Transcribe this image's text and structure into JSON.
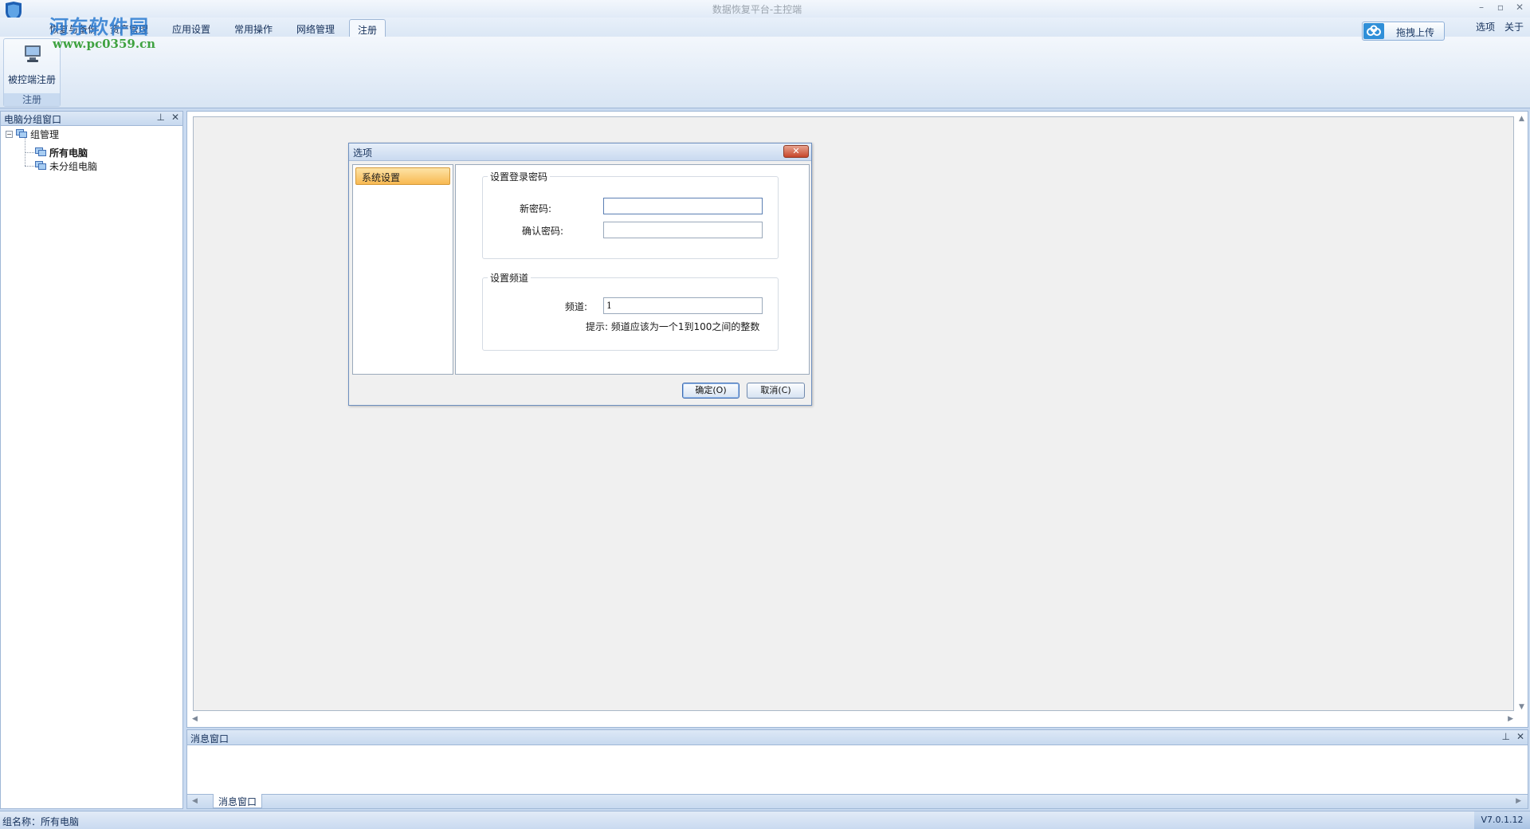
{
  "window": {
    "title": "数据恢复平台-主控端"
  },
  "watermark": {
    "text": "河东软件园",
    "url": "www.pc0359.cn"
  },
  "tabs": [
    {
      "label": "恢复与备份"
    },
    {
      "label": "资产管理"
    },
    {
      "label": "应用设置"
    },
    {
      "label": "常用操作"
    },
    {
      "label": "网络管理"
    },
    {
      "label": "注册",
      "active": true
    }
  ],
  "top_links": {
    "options": "选项",
    "about": "关于"
  },
  "upload_button": {
    "label": "拖拽上传"
  },
  "ribbon": {
    "button_label": "被控端注册",
    "group_label": "注册"
  },
  "left_panel": {
    "title": "电脑分组窗口",
    "tree": {
      "root": "组管理",
      "children": [
        "所有电脑",
        "未分组电脑"
      ]
    }
  },
  "dialog": {
    "title": "选项",
    "nav_item": "系统设置",
    "password_group": {
      "legend": "设置登录密码",
      "new_password_label": "新密码:",
      "confirm_password_label": "确认密码:",
      "new_password_value": "",
      "confirm_password_value": ""
    },
    "channel_group": {
      "legend": "设置频道",
      "channel_label": "频道:",
      "channel_value": "1",
      "hint": "提示: 频道应该为一个1到100之间的整数"
    },
    "ok_button": "确定(O)",
    "cancel_button": "取消(C)"
  },
  "message_window": {
    "title": "消息窗口",
    "tab_label": "消息窗口"
  },
  "statusbar": {
    "group_name": "组名称：所有电脑",
    "version": "V7.0.1.12"
  },
  "colors": {
    "accent": "#2f8fd8",
    "nav_selected": "#f8b951",
    "frame": "#9fb7d6"
  }
}
